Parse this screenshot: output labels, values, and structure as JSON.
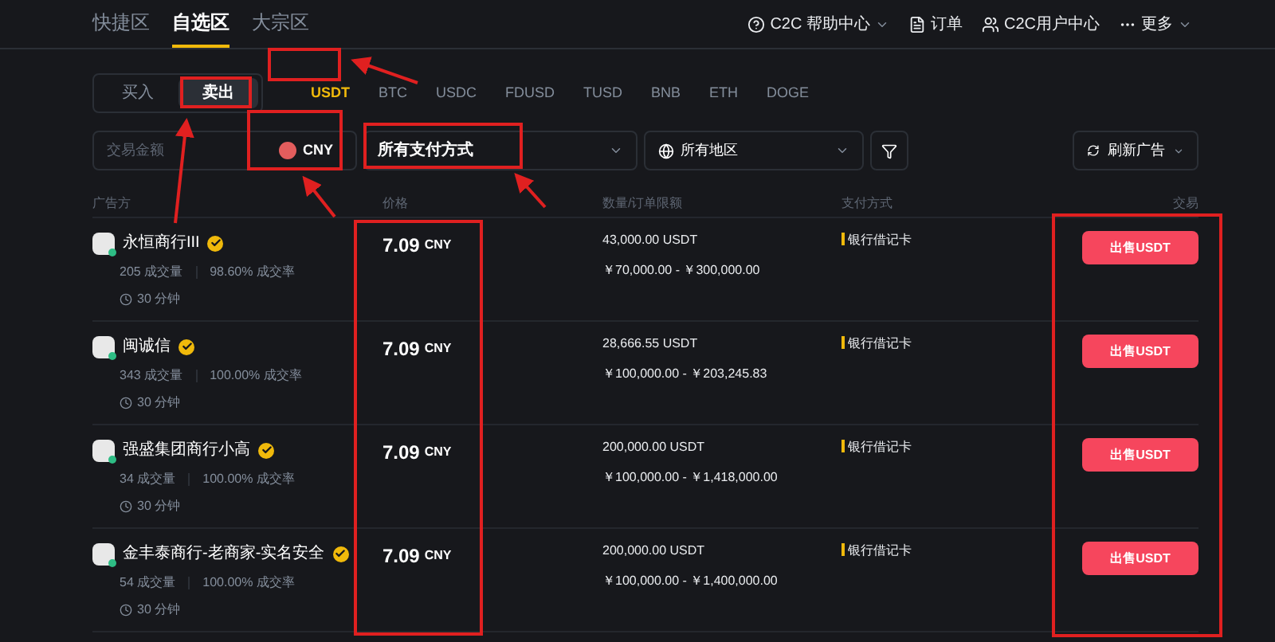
{
  "nav": {
    "tabs": [
      {
        "label": "快捷区",
        "selected": false
      },
      {
        "label": "自选区",
        "selected": true
      },
      {
        "label": "大宗区",
        "selected": false
      }
    ],
    "menu": [
      {
        "label": "C2C 帮助中心",
        "dropdown": true
      },
      {
        "label": "订单",
        "dropdown": false
      },
      {
        "label": "C2C用户中心",
        "dropdown": false
      },
      {
        "label": "更多",
        "dropdown": true
      }
    ]
  },
  "trade_side": [
    {
      "label": "买入",
      "selected": false
    },
    {
      "label": "卖出",
      "selected": true
    }
  ],
  "coins": [
    {
      "label": "USDT",
      "selected": true
    },
    {
      "label": "BTC",
      "selected": false
    },
    {
      "label": "USDC",
      "selected": false
    },
    {
      "label": "FDUSD",
      "selected": false
    },
    {
      "label": "TUSD",
      "selected": false
    },
    {
      "label": "BNB",
      "selected": false
    },
    {
      "label": "ETH",
      "selected": false
    },
    {
      "label": "DOGE",
      "selected": false
    }
  ],
  "filters": {
    "amount": {
      "placeholder": "交易金额"
    },
    "currency": {
      "value": "CNY"
    },
    "payment": {
      "value": "所有支付方式"
    },
    "region": {
      "value": "所有地区"
    },
    "refresh": {
      "label": "刷新广告"
    }
  },
  "table": {
    "columns": [
      "广告方",
      "价格",
      "数量/订单限额",
      "支付方式",
      "交易"
    ],
    "rows": [
      {
        "name": "永恒商行III",
        "trades": "205 成交量",
        "rate": "98.60% 成交率",
        "time": "30 分钟",
        "price": "7.09",
        "currency": "CNY",
        "quantity": "43,000.00 USDT",
        "limit": "￥70,000.00 - ￥300,000.00",
        "payment": "银行借记卡",
        "action": "出售USDT"
      },
      {
        "name": "闽诚信",
        "trades": "343 成交量",
        "rate": "100.00% 成交率",
        "time": "30 分钟",
        "price": "7.09",
        "currency": "CNY",
        "quantity": "28,666.55 USDT",
        "limit": "￥100,000.00 - ￥203,245.83",
        "payment": "银行借记卡",
        "action": "出售USDT"
      },
      {
        "name": "强盛集团商行小高",
        "trades": "34 成交量",
        "rate": "100.00% 成交率",
        "time": "30 分钟",
        "price": "7.09",
        "currency": "CNY",
        "quantity": "200,000.00 USDT",
        "limit": "￥100,000.00 - ￥1,418,000.00",
        "payment": "银行借记卡",
        "action": "出售USDT"
      },
      {
        "name": "金丰泰商行-老商家-实名安全",
        "trades": "54 成交量",
        "rate": "100.00% 成交率",
        "time": "30 分钟",
        "price": "7.09",
        "currency": "CNY",
        "quantity": "200,000.00 USDT",
        "limit": "￥100,000.00 - ￥1,400,000.00",
        "payment": "银行借记卡",
        "action": "出售USDT"
      }
    ]
  }
}
